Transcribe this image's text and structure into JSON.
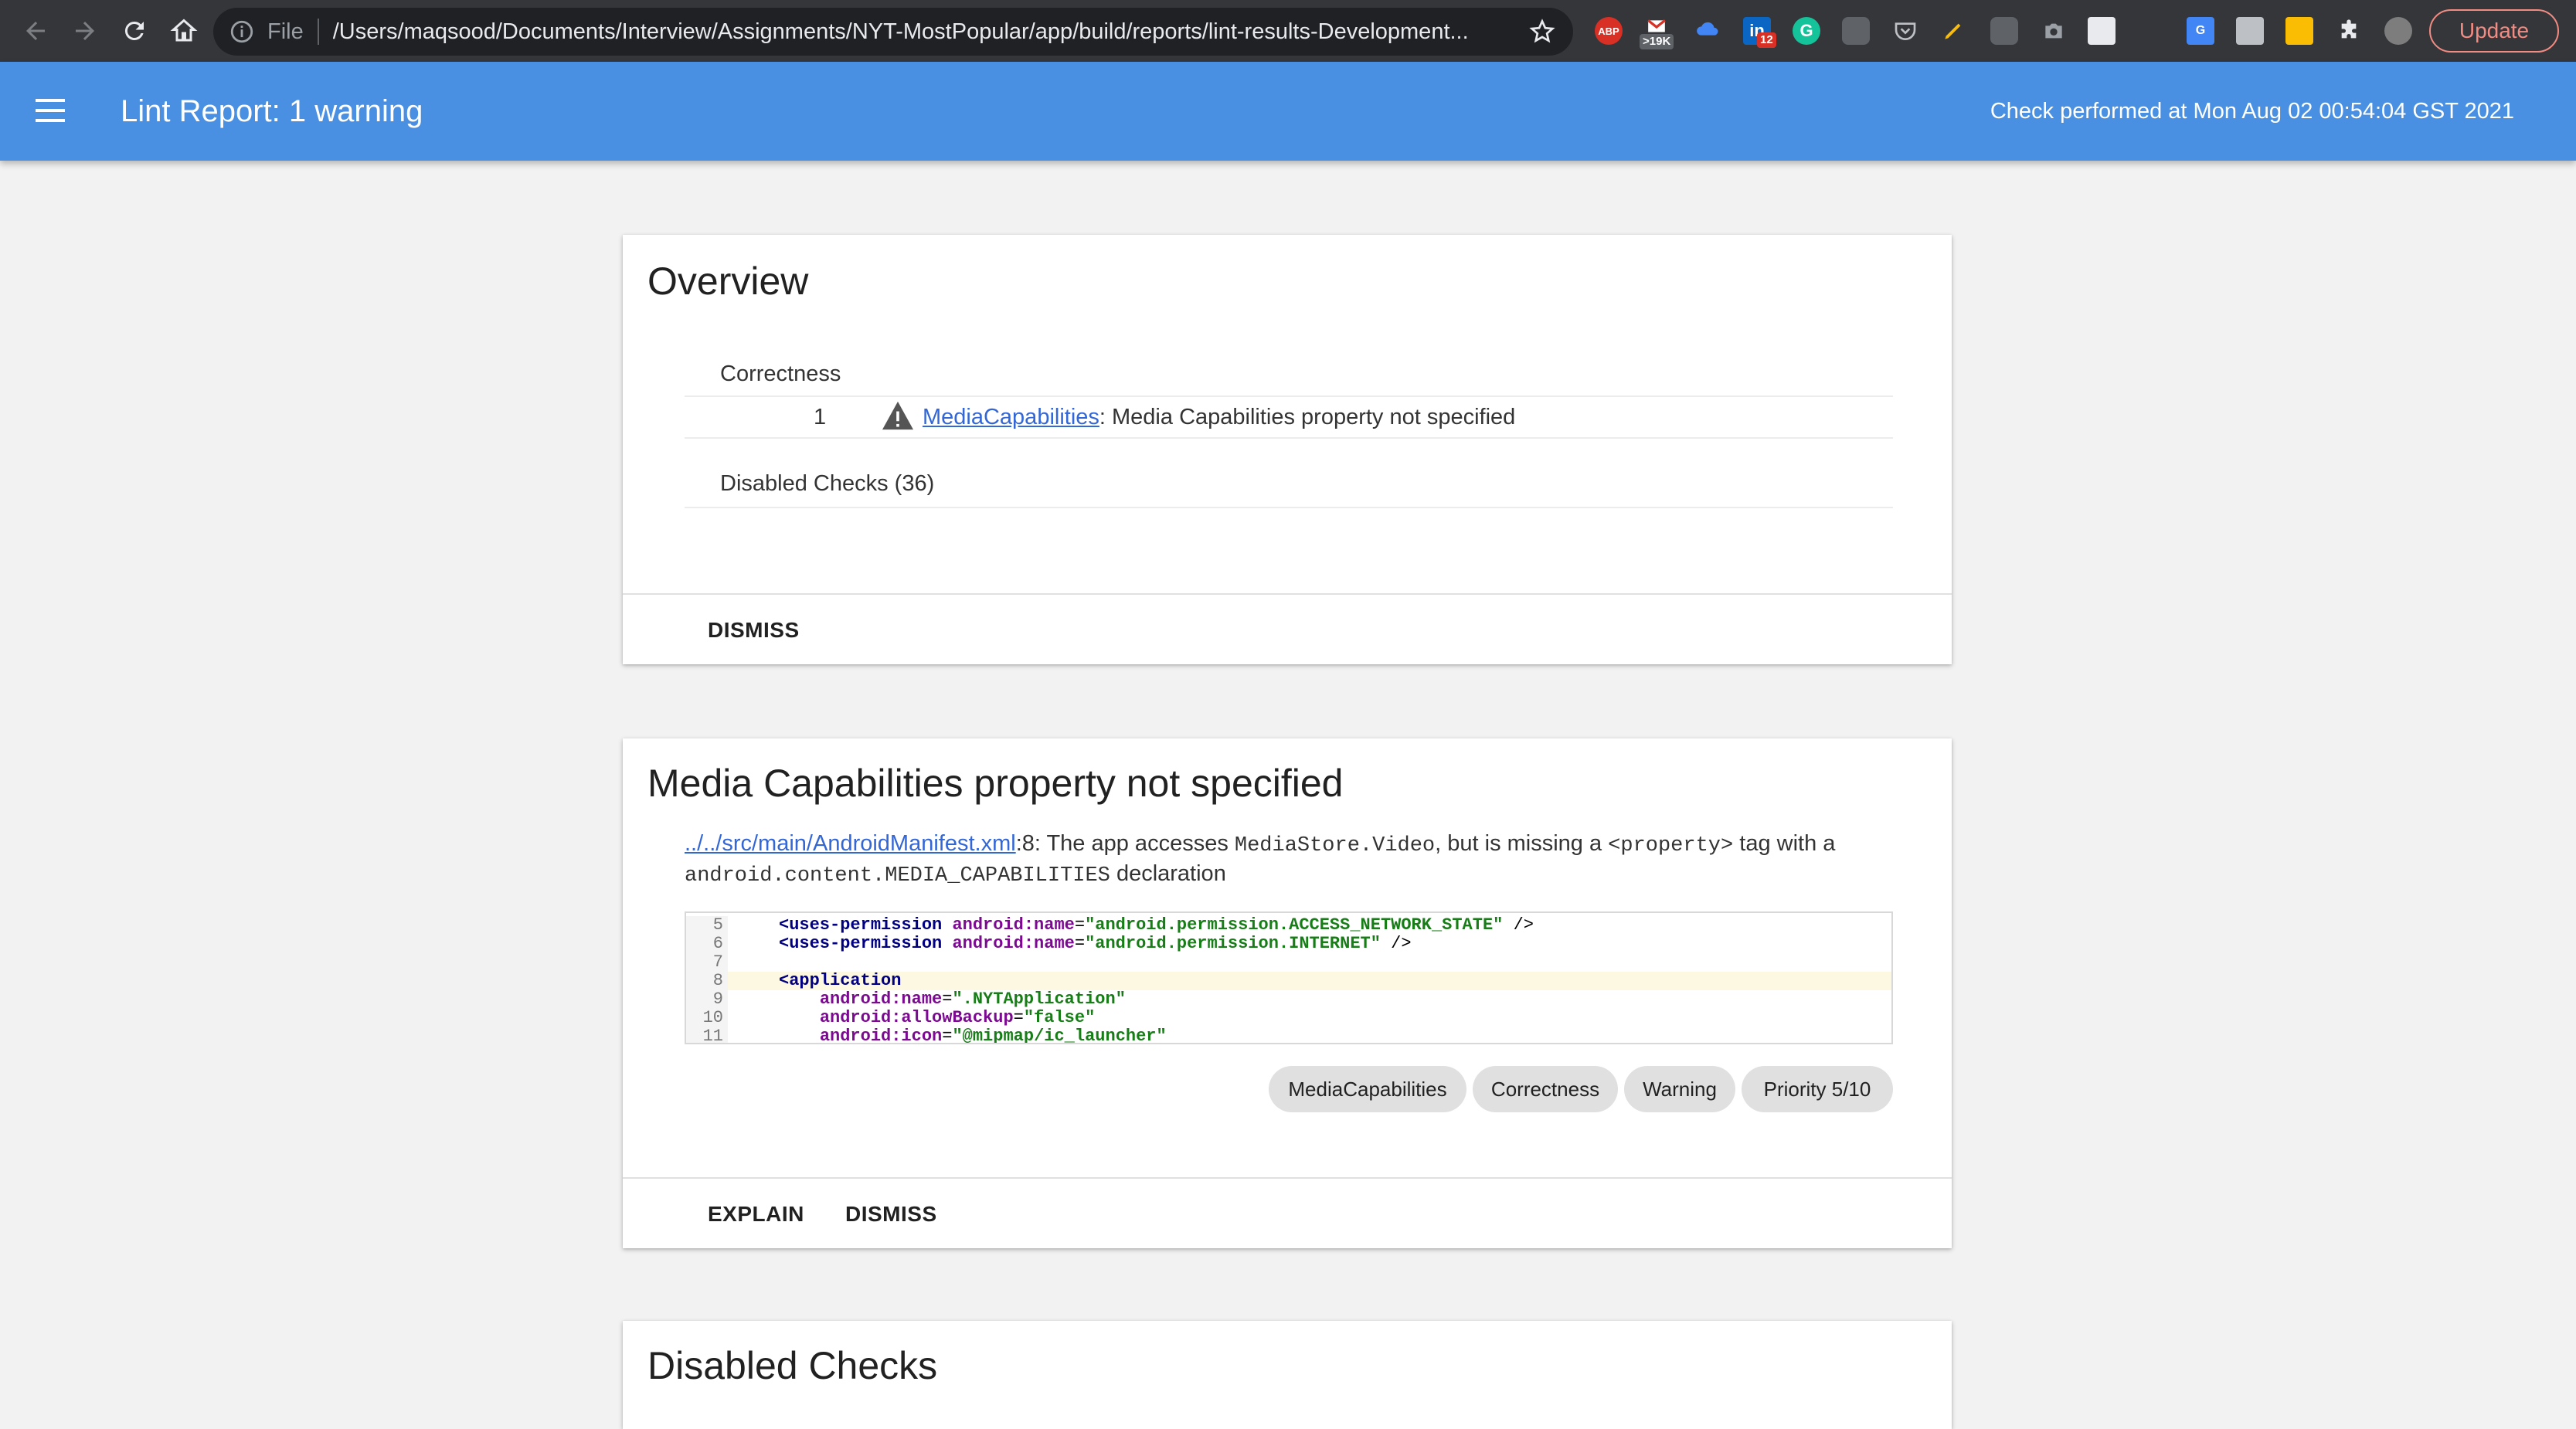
{
  "browser": {
    "scheme_label": "File",
    "url": "/Users/maqsood/Documents/Interview/Assignments/NYT-MostPopular/app/build/reports/lint-results-Development...",
    "extensions": {
      "abp_label": "ABP",
      "gmail_badge": ">19K",
      "linkedin_badge": "12"
    },
    "update_label": "Update"
  },
  "appbar": {
    "title": "Lint Report: 1 warning",
    "check_text": "Check performed at Mon Aug 02 00:54:04 GST 2021"
  },
  "overview": {
    "title": "Overview",
    "category": "Correctness",
    "issue_count": "1",
    "issue_link": "MediaCapabilities",
    "issue_text": ": Media Capabilities property not specified",
    "disabled_checks": "Disabled Checks (36)",
    "dismiss_label": "DISMISS"
  },
  "issue": {
    "title": "Media Capabilities property not specified",
    "file_link": "../../src/main/AndroidManifest.xml",
    "desc_part1": ":8: The app accesses ",
    "desc_code1": "MediaStore.Video",
    "desc_part2": ", but is missing a ",
    "desc_code2": "<property>",
    "desc_part3": " tag with a",
    "desc_code3": "android.content.MEDIA_CAPABILITIES",
    "desc_part4": " declaration",
    "code_lines": [
      {
        "n": "5",
        "pre": "<uses-permission ",
        "attr": "android:name",
        "eq": "=",
        "val": "\"android.permission.ACCESS_NETWORK_STATE\"",
        "post": " />"
      },
      {
        "n": "6",
        "pre": "<uses-permission ",
        "attr": "android:name",
        "eq": "=",
        "val": "\"android.permission.INTERNET\"",
        "post": " />"
      },
      {
        "n": "7",
        "pre": "",
        "attr": "",
        "eq": "",
        "val": "",
        "post": ""
      },
      {
        "n": "8",
        "pre": "<application",
        "attr": "",
        "eq": "",
        "val": "",
        "post": ""
      },
      {
        "n": "9",
        "pre": "    ",
        "attr": "android:name",
        "eq": "=",
        "val": "\".NYTApplication\"",
        "post": ""
      },
      {
        "n": "10",
        "pre": "    ",
        "attr": "android:allowBackup",
        "eq": "=",
        "val": "\"false\"",
        "post": ""
      },
      {
        "n": "11",
        "pre": "    ",
        "attr": "android:icon",
        "eq": "=",
        "val": "\"@mipmap/ic_launcher\"",
        "post": ""
      }
    ],
    "chips": [
      "MediaCapabilities",
      "Correctness",
      "Warning",
      "Priority 5/10"
    ],
    "explain_label": "EXPLAIN",
    "dismiss_label": "DISMISS"
  },
  "disabled": {
    "title": "Disabled Checks"
  }
}
